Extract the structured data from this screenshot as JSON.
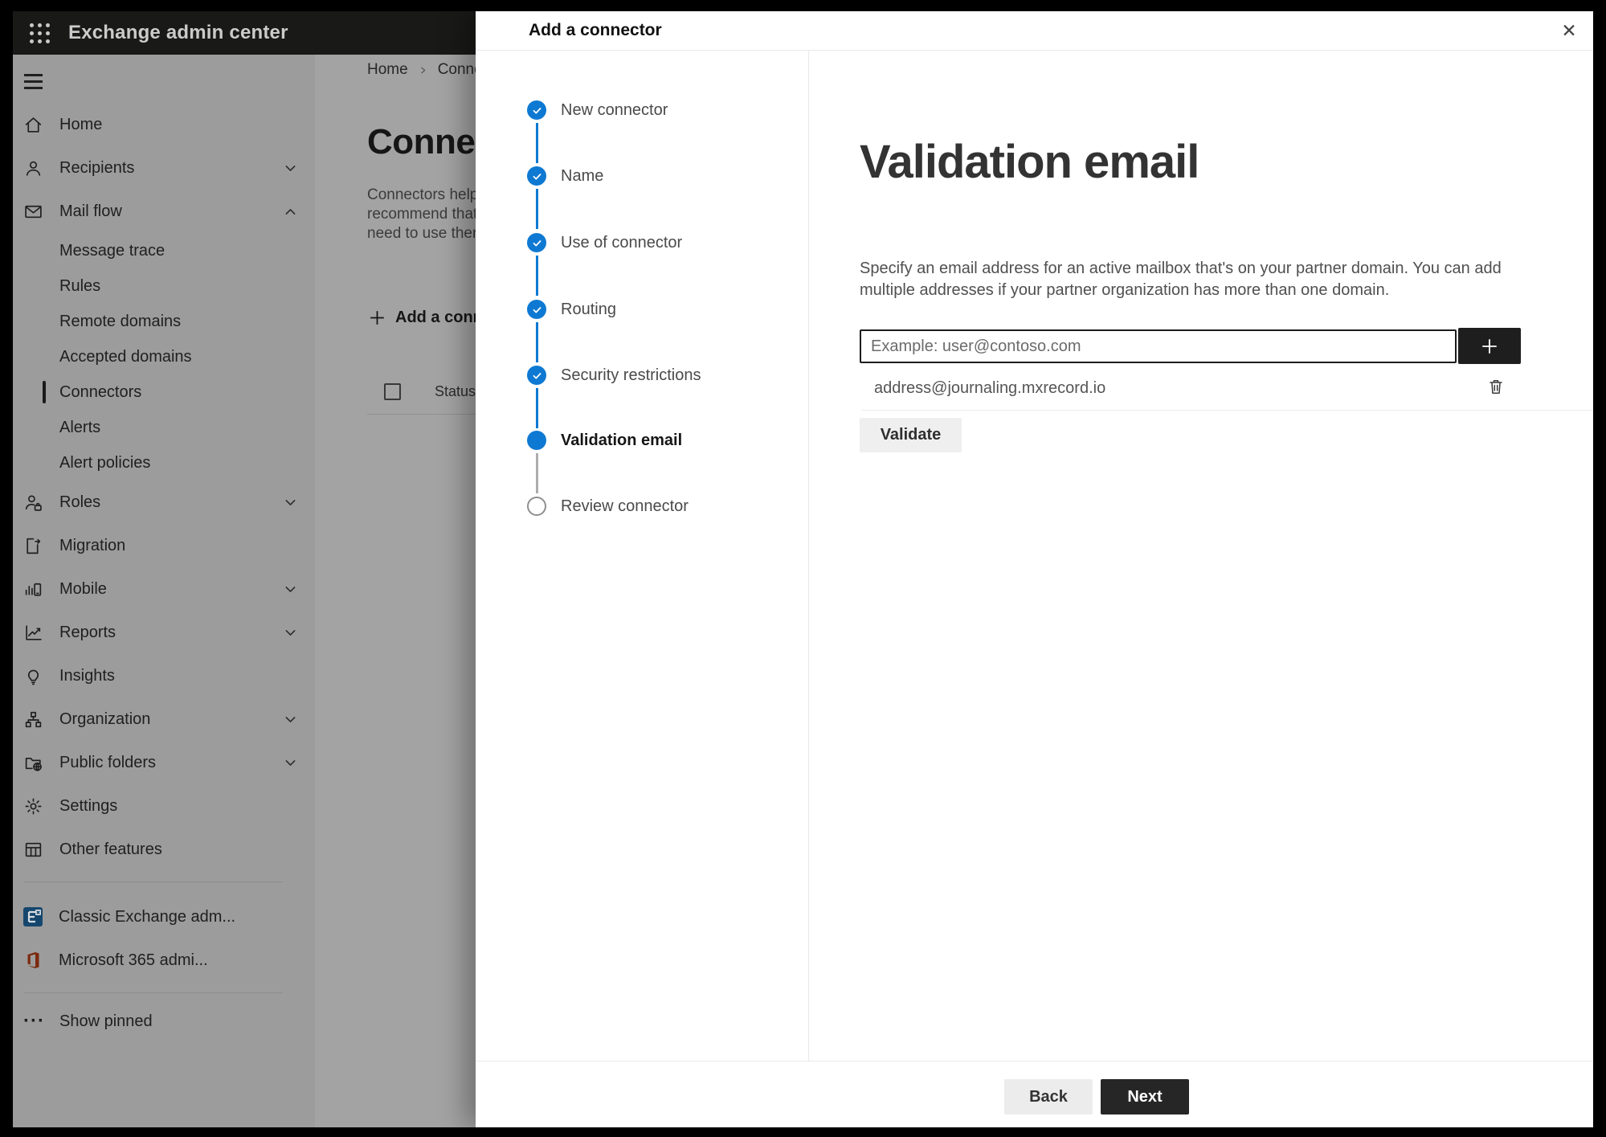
{
  "header": {
    "app_title": "Exchange admin center"
  },
  "sidebar": {
    "items": [
      {
        "label": "Home"
      },
      {
        "label": "Recipients"
      },
      {
        "label": "Mail flow"
      },
      {
        "label": "Message trace"
      },
      {
        "label": "Rules"
      },
      {
        "label": "Remote domains"
      },
      {
        "label": "Accepted domains"
      },
      {
        "label": "Connectors"
      },
      {
        "label": "Alerts"
      },
      {
        "label": "Alert policies"
      },
      {
        "label": "Roles"
      },
      {
        "label": "Migration"
      },
      {
        "label": "Mobile"
      },
      {
        "label": "Reports"
      },
      {
        "label": "Insights"
      },
      {
        "label": "Organization"
      },
      {
        "label": "Public folders"
      },
      {
        "label": "Settings"
      },
      {
        "label": "Other features"
      },
      {
        "label": "Classic Exchange adm..."
      },
      {
        "label": "Microsoft 365 admi..."
      },
      {
        "label": "Show pinned"
      }
    ],
    "selected_item": "Connectors",
    "ellipsis_icon": "···"
  },
  "background_page": {
    "breadcrumb": {
      "home": "Home",
      "current": "Conne"
    },
    "title": "Connec",
    "description_lines": [
      "Connectors help",
      "recommend that",
      "need to use ther"
    ],
    "add_button_label": "Add a conn",
    "table": {
      "status_header": "Status"
    }
  },
  "modal": {
    "title": "Add a connector",
    "close_icon": "✕",
    "steps": [
      {
        "label": "New connector",
        "state": "done"
      },
      {
        "label": "Name",
        "state": "done"
      },
      {
        "label": "Use of connector",
        "state": "done"
      },
      {
        "label": "Routing",
        "state": "done"
      },
      {
        "label": "Security restrictions",
        "state": "done"
      },
      {
        "label": "Validation email",
        "state": "current"
      },
      {
        "label": "Review connector",
        "state": "upcoming"
      }
    ],
    "content": {
      "heading": "Validation email",
      "description_lines": [
        "Specify an email address for an active mailbox that's on your partner domain. You can add",
        "multiple addresses if your partner organization has more than one domain."
      ],
      "email_input": {
        "value": "",
        "placeholder": "Example: user@contoso.com"
      },
      "addresses": [
        {
          "email": "address@journaling.mxrecord.io"
        }
      ],
      "validate_button_label": "Validate"
    },
    "footer": {
      "back_button_label": "Back",
      "next_button_label": "Next"
    }
  },
  "colors": {
    "accent_blue": "#0e79d2",
    "header_bg": "#191918",
    "dimmed_sidebar_bg": "#9c9c9c",
    "dimmed_page_bg": "#a3a3a3",
    "modal_bg": "#ffffff",
    "primary_button_bg": "#262626",
    "input_border": "#1c1c1c"
  }
}
